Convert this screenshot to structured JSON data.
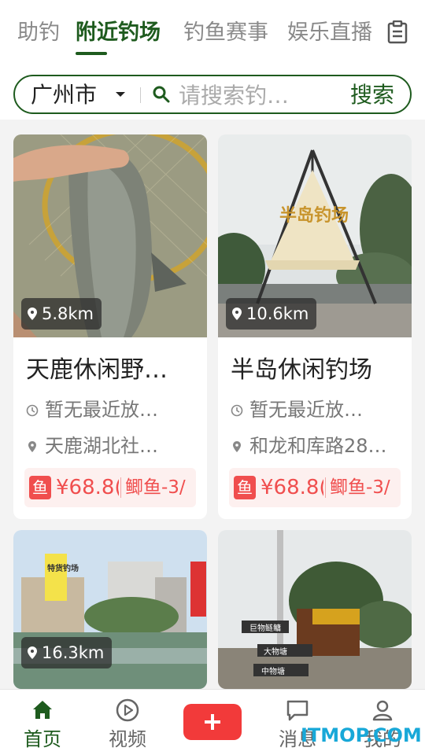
{
  "tabs": [
    {
      "label": "助钓"
    },
    {
      "label": "附近钓场"
    },
    {
      "label": "钓鱼赛事"
    },
    {
      "label": "娱乐直播"
    }
  ],
  "search": {
    "city": "广州市",
    "placeholder": "请搜索钓…",
    "button_label": "搜索"
  },
  "cards": [
    {
      "distance": "5.8km",
      "title": "天鹿休闲野…",
      "release": "暂无最近放…",
      "address": "天鹿湖北社…",
      "fish_tag": "鱼",
      "price": "¥68.8(",
      "fish": "鲫鱼-3/"
    },
    {
      "distance": "10.6km",
      "title": "半岛休闲钓场",
      "release": "暂无最近放…",
      "address": "和龙和库路28…",
      "fish_tag": "鱼",
      "price": "¥68.8(",
      "fish": "鲫鱼-3/"
    },
    {
      "distance": "16.3km"
    },
    {}
  ],
  "image_text": {
    "card2_sign": "半岛钓场",
    "card3_sign": "特货钓场",
    "card4_sign_1": "巨物鲢鳙",
    "card4_sign_2": "大物塘",
    "card4_sign_3": "中物塘"
  },
  "navbar": {
    "items": [
      {
        "label": "首页"
      },
      {
        "label": "视频"
      },
      {
        "label": "消息"
      },
      {
        "label": "我的"
      }
    ]
  },
  "watermark": "ITMOP.COM",
  "colors": {
    "accent": "#1e5b1e",
    "price_red": "#f04e4e",
    "add_button": "#f23a3a"
  }
}
